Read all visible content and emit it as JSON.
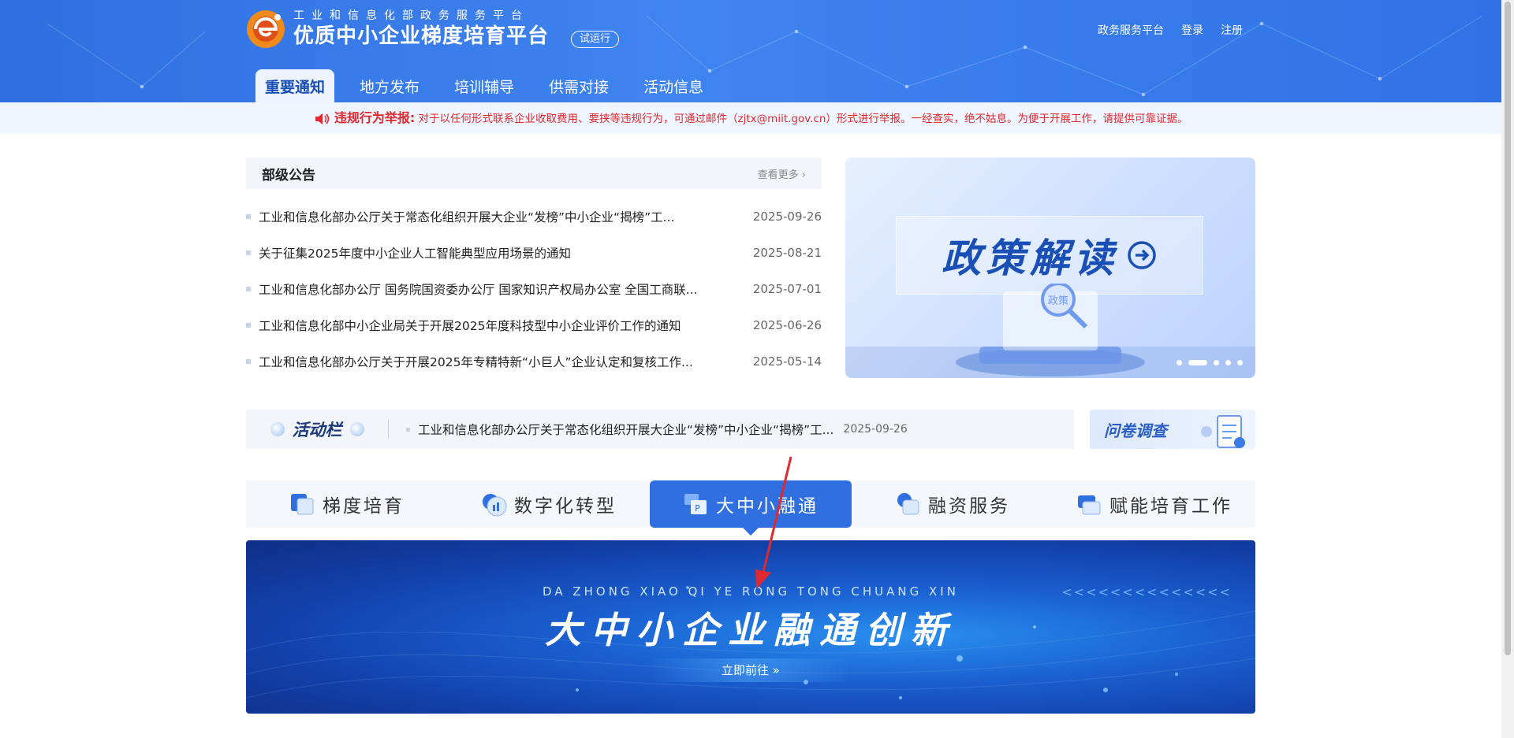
{
  "header": {
    "subtitle": "工业和信息化部政务服务平台",
    "title": "优质中小企业梯度培育平台",
    "badge": "试运行",
    "links": [
      "政务服务平台",
      "登录",
      "注册"
    ]
  },
  "nav": {
    "items": [
      "重要通知",
      "地方发布",
      "培训辅导",
      "供需对接",
      "活动信息"
    ],
    "active": "重要通知"
  },
  "notice": {
    "title": "违规行为举报:",
    "text": "对于以任何形式联系企业收取费用、要挟等违规行为，可通过邮件（zjtx@miit.gov.cn）形式进行举报。一经查实，绝不姑息。为便于开展工作，请提供可靠证据。"
  },
  "announcement": {
    "title": "部级公告",
    "more": "查看更多",
    "items": [
      {
        "text": "工业和信息化部办公厅关于常态化组织开展大企业“发榜”中小企业“揭榜”工...",
        "date": "2025-09-26"
      },
      {
        "text": "关于征集2025年度中小企业人工智能典型应用场景的通知",
        "date": "2025-08-21"
      },
      {
        "text": "工业和信息化部办公厅 国务院国资委办公厅 国家知识产权局办公室 全国工商联...",
        "date": "2025-07-01"
      },
      {
        "text": "工业和信息化部中小企业局关于开展2025年度科技型中小企业评价工作的通知",
        "date": "2025-06-26"
      },
      {
        "text": "工业和信息化部办公厅关于开展2025年专精特新“小巨人”企业认定和复核工作...",
        "date": "2025-05-14"
      }
    ]
  },
  "banner": {
    "title": "政策解读",
    "stage_label": "政策",
    "slide_count": 5,
    "active_slide": 2
  },
  "activity": {
    "label": "活动栏",
    "text": "工业和信息化部办公厅关于常态化组织开展大企业“发榜”中小企业“揭榜”工...",
    "date": "2025-09-26"
  },
  "survey": {
    "label": "问卷调查"
  },
  "tabs": {
    "items": [
      "梯度培育",
      "数字化转型",
      "大中小融通",
      "融资服务",
      "赋能培育工作"
    ],
    "active": "大中小融通"
  },
  "promo": {
    "pinyin": "DA ZHONG XIAO QI YE RONG TONG CHUANG XIN",
    "title": "大中小企业融通创新",
    "button": "立即前往",
    "chevrons": "<<<<<<<<<<<<<<"
  },
  "colors": {
    "brand": "#2f6fe0",
    "notice_red": "#e0282e",
    "annotation_red": "#e0282e"
  }
}
